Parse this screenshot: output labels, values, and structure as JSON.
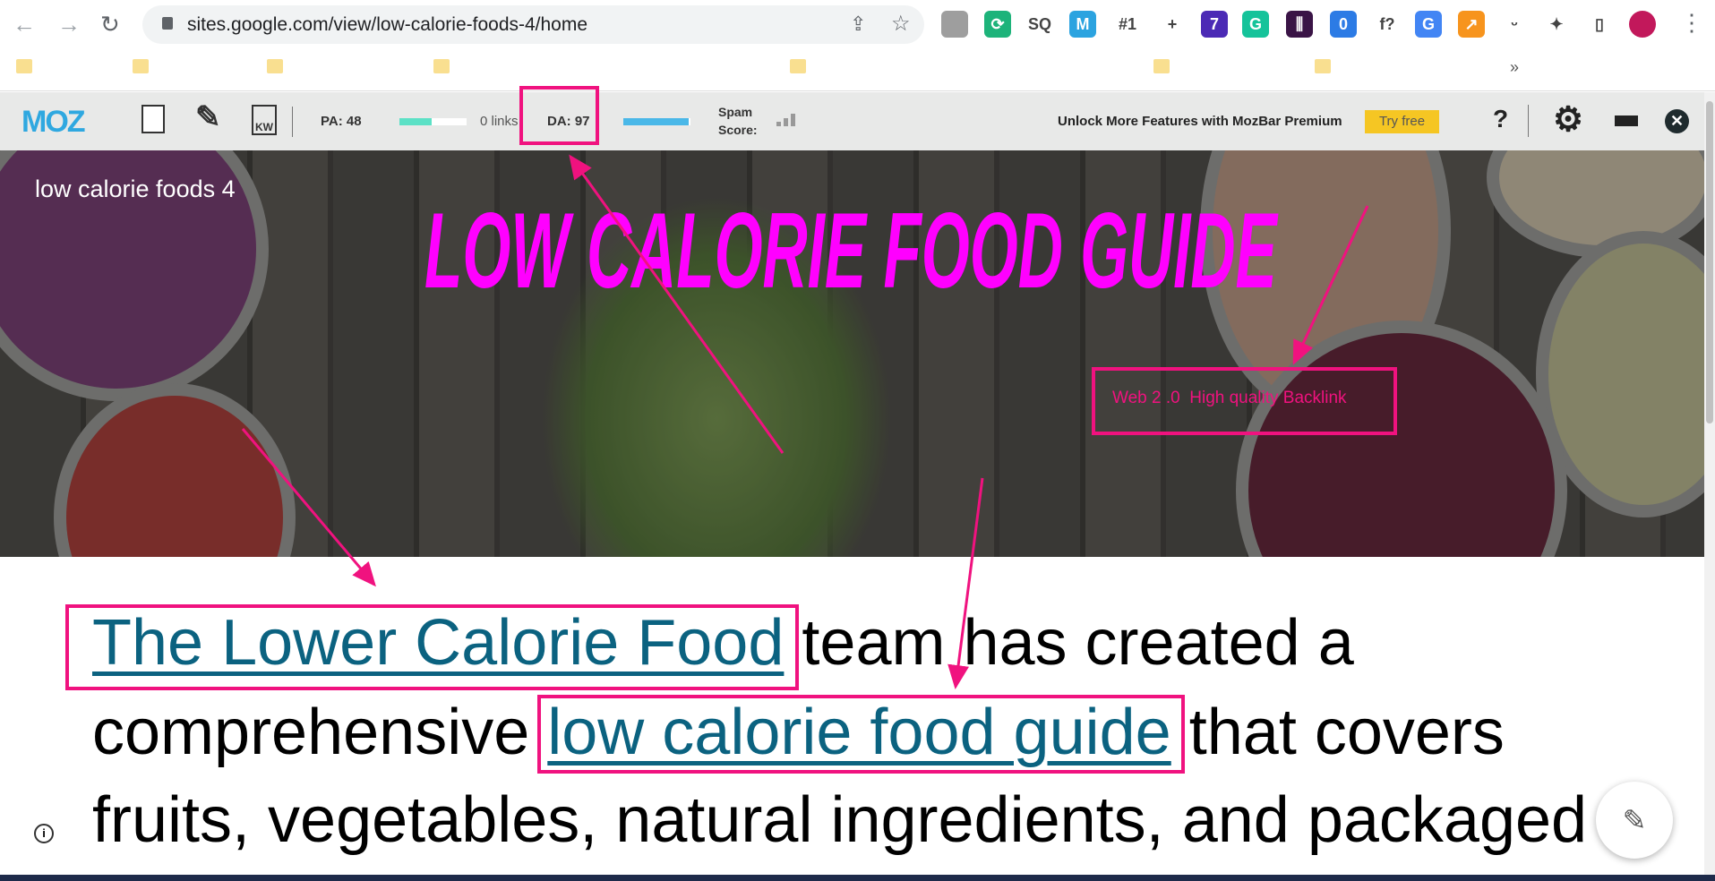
{
  "browser": {
    "url": "sites.google.com/view/low-calorie-foods-4/home",
    "extensions": [
      {
        "name": "profile-ext",
        "label": "",
        "color": "#9e9e9e"
      },
      {
        "name": "sync-ext",
        "label": "⟳",
        "color": "#1db37a"
      },
      {
        "name": "sq-ext",
        "label": "SQ",
        "color": "#ffffff"
      },
      {
        "name": "m-ext",
        "label": "M",
        "color": "#2ba3e0"
      },
      {
        "name": "rank-ext",
        "label": "#1",
        "color": "#ffffff"
      },
      {
        "name": "plus-ext",
        "label": "+",
        "color": "#e7e7e7"
      },
      {
        "name": "diamond-ext",
        "label": "7",
        "color": "#4b2ab5"
      },
      {
        "name": "grammarly-ext",
        "label": "G",
        "color": "#15c39a"
      },
      {
        "name": "chart-ext",
        "label": "⫼",
        "color": "#3a1446"
      },
      {
        "name": "drop-ext",
        "label": "0",
        "color": "#2c7be5"
      },
      {
        "name": "font-ext",
        "label": "f?",
        "color": "#ffffff"
      },
      {
        "name": "translate-ext",
        "label": "G",
        "color": "#4285f4"
      },
      {
        "name": "arrow-ext",
        "label": "↗",
        "color": "#f7941d"
      },
      {
        "name": "smile-ext",
        "label": "ᵕ",
        "color": "#ffffff"
      },
      {
        "name": "puzzle-ext",
        "label": "✦",
        "color": "#ffffff"
      },
      {
        "name": "sidepanel-ext",
        "label": "▯",
        "color": "#ffffff"
      },
      {
        "name": "avatar",
        "label": "",
        "color": "#c2185b"
      }
    ],
    "bookmarks_more": "»"
  },
  "mozbar": {
    "logo": "MOZ",
    "pa_label": "PA: 48",
    "pa_fill_percent": 48,
    "links_label": "0 links",
    "da_label": "DA: 97",
    "da_fill_percent": 97,
    "spam_label_1": "Spam",
    "spam_label_2": "Score:",
    "promo": "Unlock More Features with MozBar Premium",
    "try_free": "Try free",
    "help": "?"
  },
  "page": {
    "site_title": "low calorie foods 4",
    "hero_title": "LOW CALORIE FOOD GUIDE",
    "annotation": "Web 2 .0  High quality Backlink",
    "line1_link": "The Lower Calorie Food",
    "line1_rest": " team has created a",
    "line2_start": "comprehensive ",
    "line2_link": "low calorie food guide",
    "line2_rest": " that covers",
    "line3": "fruits, vegetables, natural ingredients, and packaged"
  },
  "colors": {
    "annotation": "#f0127f",
    "link": "#0b6280",
    "hero_title": "#ff00ff",
    "moz_blue": "#2fa8e0"
  }
}
